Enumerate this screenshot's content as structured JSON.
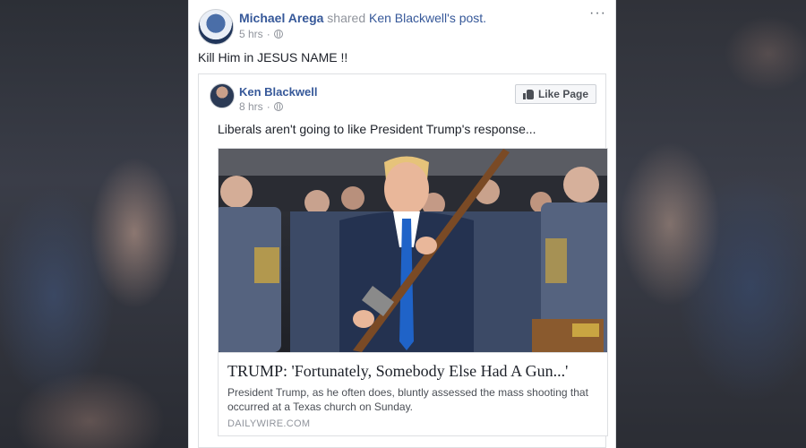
{
  "post": {
    "author_name": "Michael Arega",
    "action": "shared",
    "shared_from": "Ken Blackwell's post.",
    "time": "5 hrs",
    "separator": "·",
    "more": "···",
    "text": "Kill Him in JESUS NAME !!"
  },
  "shared_post": {
    "author_name": "Ken Blackwell",
    "time": "8 hrs",
    "separator": "·",
    "like_button": "Like Page",
    "text": "Liberals aren't going to like President Trump's response...",
    "link": {
      "title": "TRUMP: 'Fortunately, Somebody Else Had A Gun...'",
      "description": "President Trump, as he often does, bluntly assessed the mass shooting that occurred at a Texas church on Sunday.",
      "domain": "DAILYWIRE.COM"
    }
  },
  "icons": [
    "globe-icon",
    "like-thumb-icon",
    "more-options-icon"
  ],
  "colors": {
    "link_blue": "#365899",
    "meta_gray": "#90949c",
    "text": "#1d2129"
  }
}
